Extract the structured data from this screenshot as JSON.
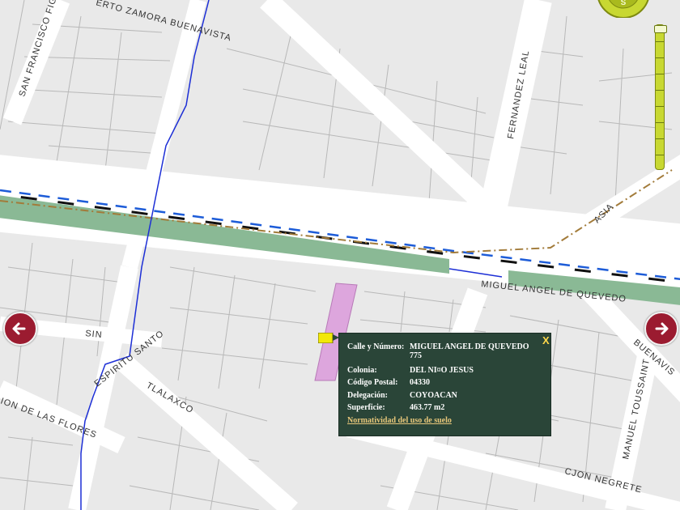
{
  "streets": {
    "san_francisco": "SAN FRANCISCO FIG",
    "zamora": "ERTO ZAMORA BUENAVISTA",
    "fernandez_leal": "FERNANDEZ LEAL",
    "asia": "ASIA",
    "miguel_angel": "MIGUEL ANGEL DE QUEVEDO",
    "buenavista": "BUENAVIS",
    "sin": "SIN",
    "espiritu_santo": "ESPIRITU SANTO",
    "tlalaxco": "TLALAXCO",
    "flores": "ION DE LAS FLORES",
    "manuel_toussaint": "MANUEL TOUSSAINT",
    "cjon_negrete": "CJON NEGRETE"
  },
  "popup": {
    "rows": [
      {
        "label": "Calle y Número:",
        "value": "MIGUEL ANGEL DE QUEVEDO 775"
      },
      {
        "label": "Colonia:",
        "value": "DEL NI¤O JESUS"
      },
      {
        "label": "Código Postal:",
        "value": "04330"
      },
      {
        "label": "Delegación:",
        "value": "COYOACAN"
      },
      {
        "label": "Superficie:",
        "value": "463.77 m2"
      }
    ],
    "link": "Normatividad del uso de suelo",
    "close": "X"
  },
  "controls": {
    "compass_letter": "S",
    "zoom_level_fraction": 0.0
  },
  "colors": {
    "map_bg": "#e9e9e9",
    "road": "#ffffff",
    "median": "#8ab995",
    "parcel": "#dda6dd",
    "popup_bg": "#2a4538",
    "nav_button": "#9b1b30",
    "zoom_bar": "#c8d832",
    "boundary_blue": "#1d5cd8",
    "rail_dash": "#111111",
    "brown_line": "#a27b3a"
  }
}
